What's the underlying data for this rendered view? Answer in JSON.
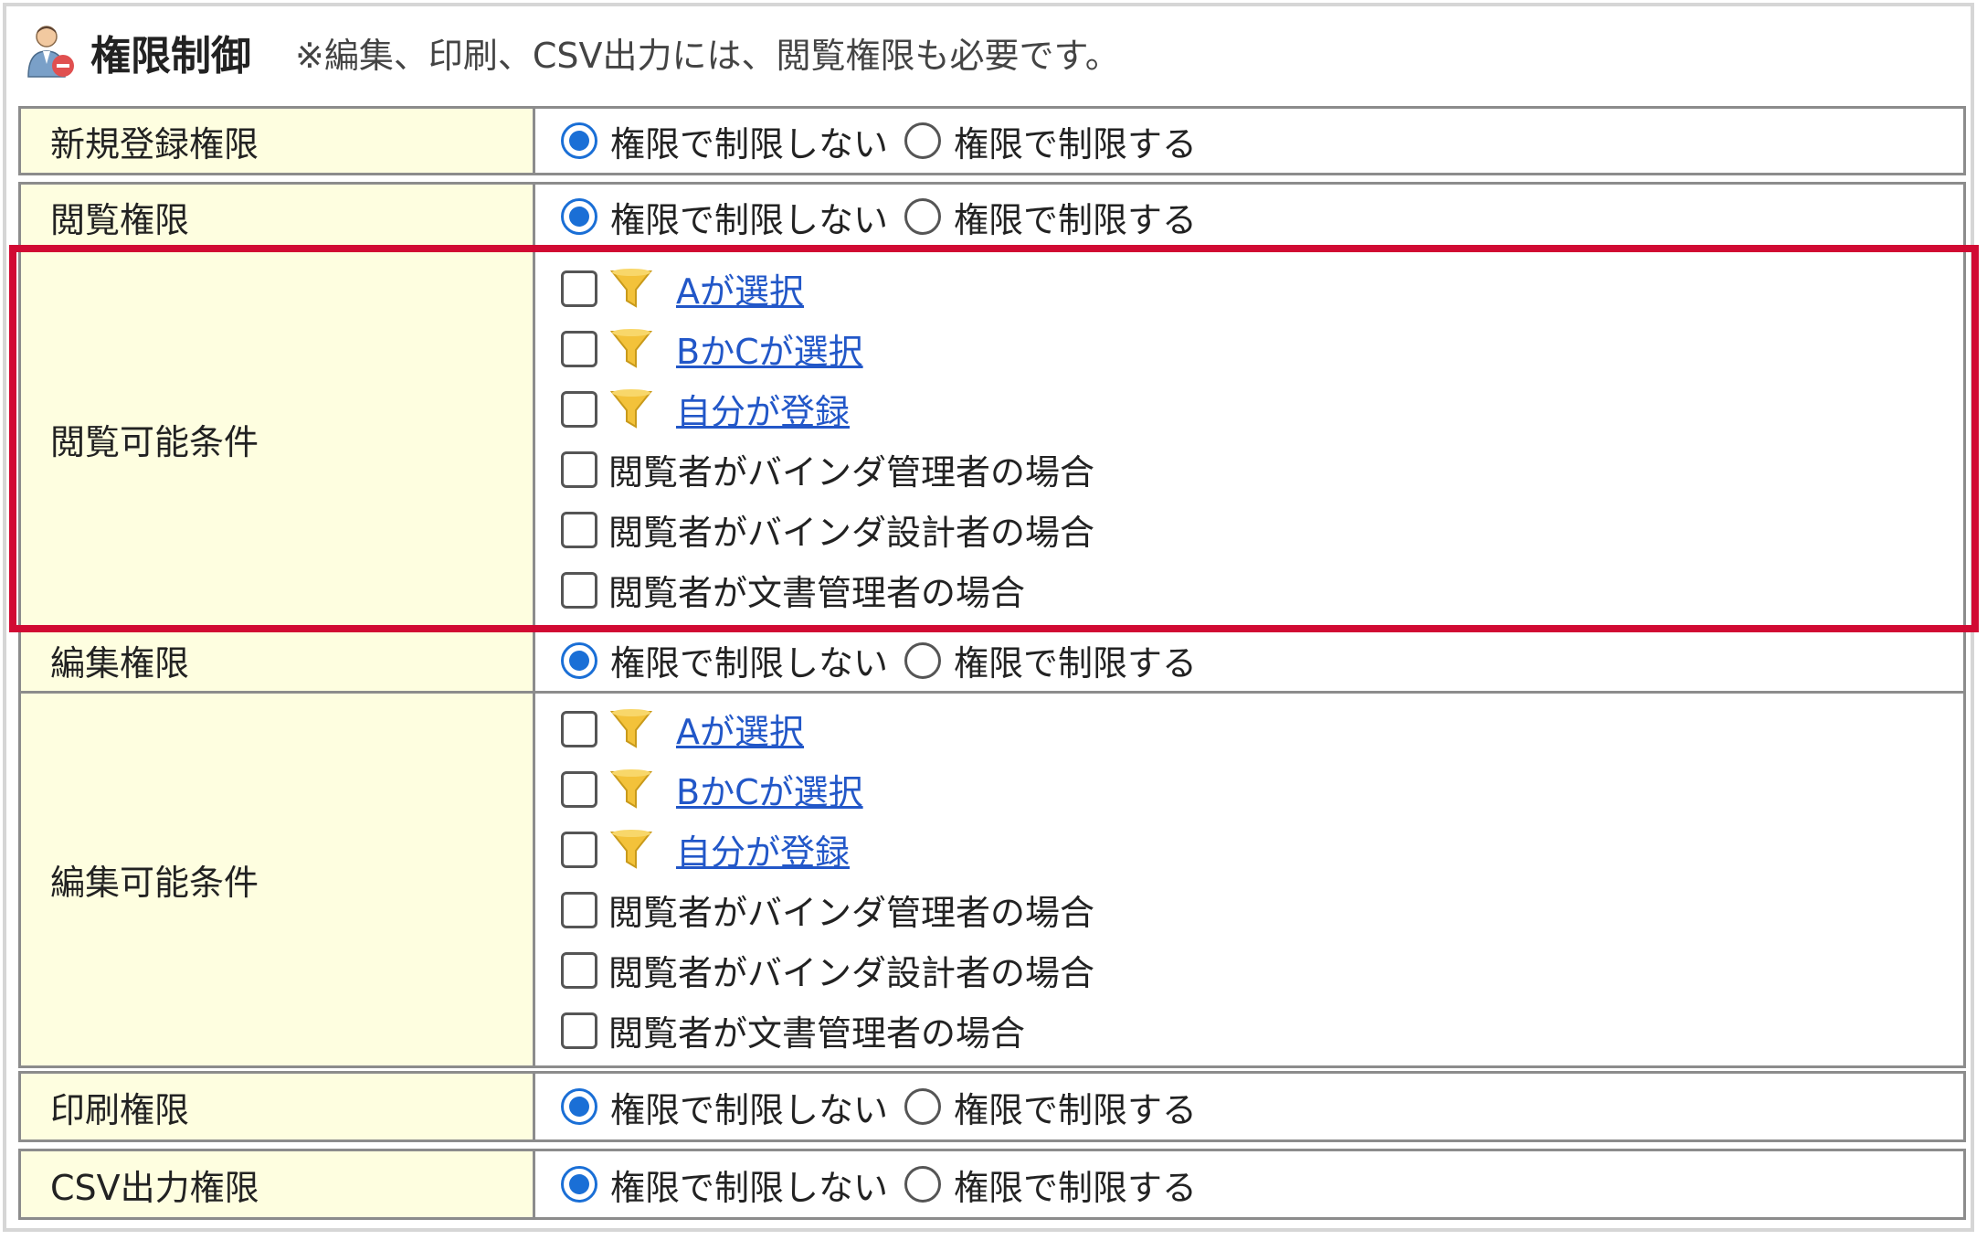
{
  "header": {
    "title": "権限制御",
    "note": "※編集、印刷、CSV出力には、閲覧権限も必要です。"
  },
  "radio_options": {
    "no_restrict": "権限で制限しない",
    "restrict": "権限で制限する"
  },
  "permissions": {
    "new_registration": {
      "label": "新規登録権限",
      "selected": "no_restrict"
    },
    "view": {
      "label": "閲覧権限",
      "selected": "no_restrict"
    },
    "view_conditions": {
      "label": "閲覧可能条件",
      "items": [
        {
          "text": "Aが選択",
          "type": "filter-link",
          "checked": false
        },
        {
          "text": "BかCが選択",
          "type": "filter-link",
          "checked": false
        },
        {
          "text": "自分が登録",
          "type": "filter-link",
          "checked": false
        },
        {
          "text": "閲覧者がバインダ管理者の場合",
          "type": "text",
          "checked": false
        },
        {
          "text": "閲覧者がバインダ設計者の場合",
          "type": "text",
          "checked": false
        },
        {
          "text": "閲覧者が文書管理者の場合",
          "type": "text",
          "checked": false
        }
      ]
    },
    "edit": {
      "label": "編集権限",
      "selected": "no_restrict"
    },
    "edit_conditions": {
      "label": "編集可能条件",
      "items": [
        {
          "text": "Aが選択",
          "type": "filter-link",
          "checked": false
        },
        {
          "text": "BかCが選択",
          "type": "filter-link",
          "checked": false
        },
        {
          "text": "自分が登録",
          "type": "filter-link",
          "checked": false
        },
        {
          "text": "閲覧者がバインダ管理者の場合",
          "type": "text",
          "checked": false
        },
        {
          "text": "閲覧者がバインダ設計者の場合",
          "type": "text",
          "checked": false
        },
        {
          "text": "閲覧者が文書管理者の場合",
          "type": "text",
          "checked": false
        }
      ]
    },
    "print": {
      "label": "印刷権限",
      "selected": "no_restrict"
    },
    "csv": {
      "label": "CSV出力権限",
      "selected": "no_restrict"
    }
  },
  "icons": {
    "header": "user-permission-icon",
    "condition": "filter-icon"
  },
  "colors": {
    "label_bg": "#fefee0",
    "link": "#2257c8",
    "radio_selected": "#1a6fd6",
    "highlight": "#d10a33"
  }
}
